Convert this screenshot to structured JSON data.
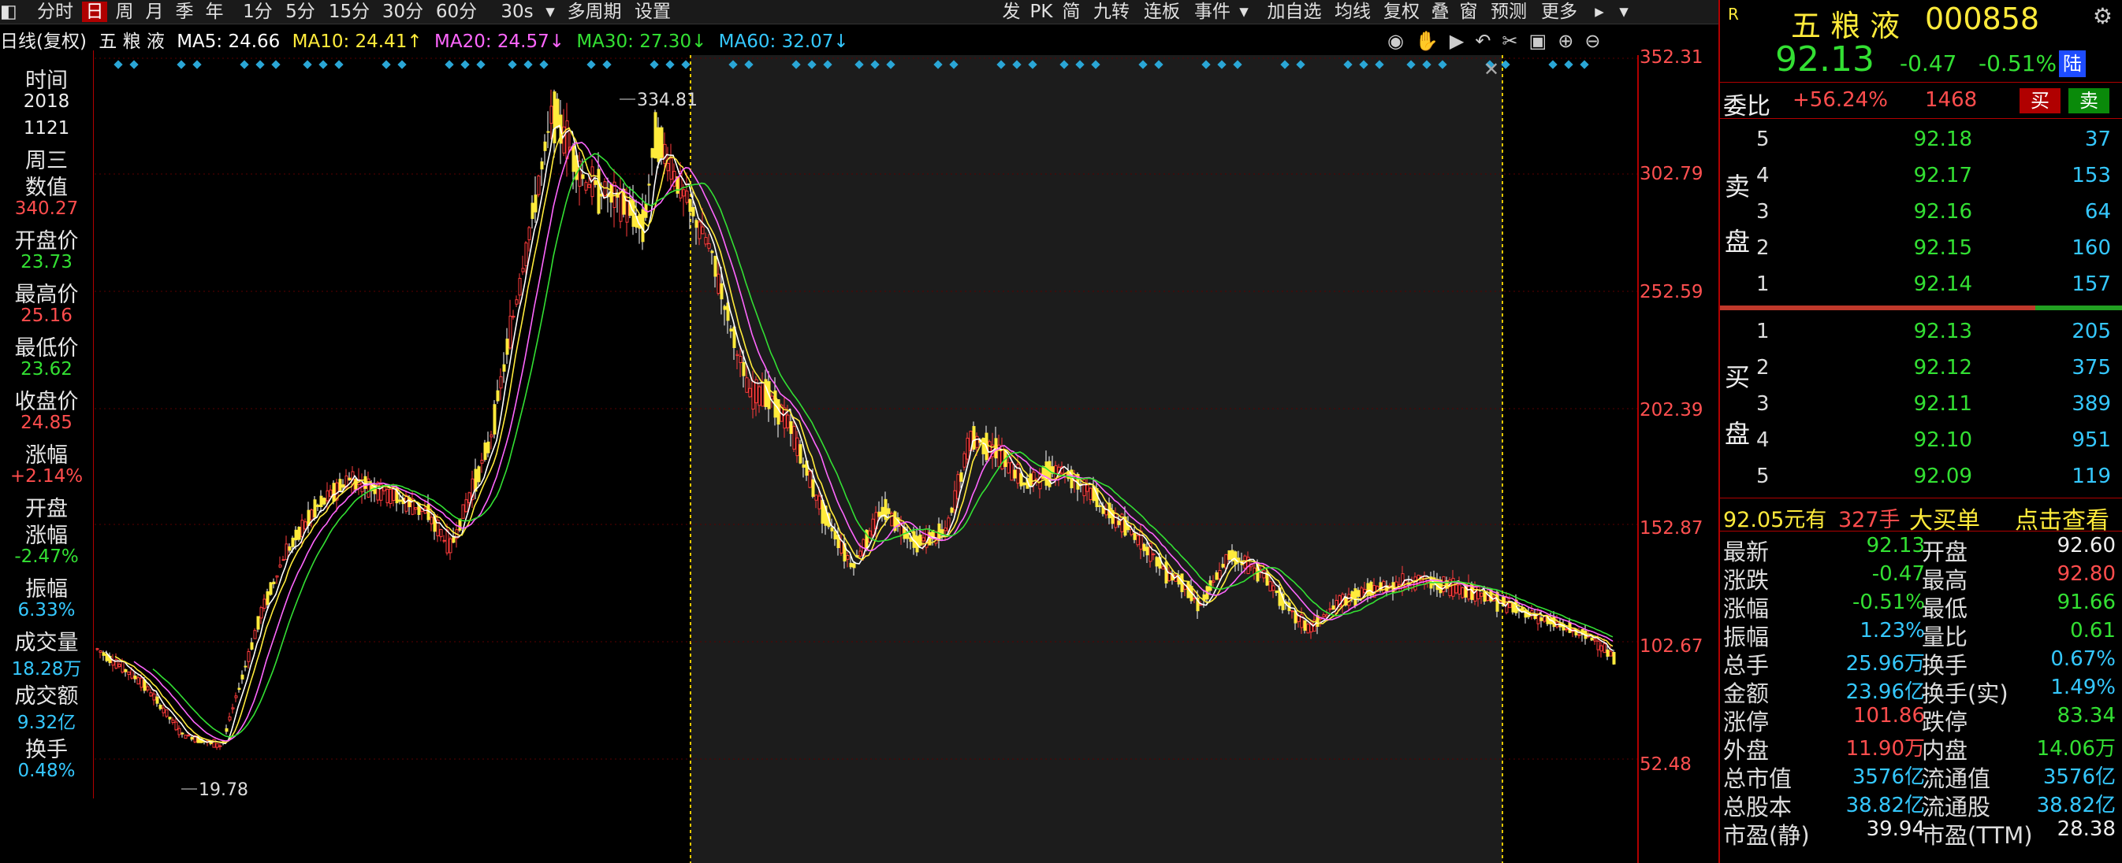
{
  "toolbar": {
    "items": [
      "分时",
      "日",
      "周",
      "月",
      "季",
      "年",
      "1分",
      "5分",
      "15分",
      "30分",
      "60分",
      "30s",
      "多周期",
      "设置"
    ],
    "active_item": "日",
    "right_items": [
      "发",
      "PK",
      "简",
      "九转",
      "连板",
      "事件",
      "加自选",
      "均线",
      "复权",
      "叠",
      "窗",
      "预测",
      "更多"
    ]
  },
  "ma_bar": {
    "period": "日线(复权)",
    "stock_name": "五 粮 液",
    "ma5": "MA5: 24.66",
    "ma10": "MA10: 24.41↑",
    "ma20": "MA20: 24.57↓",
    "ma30": "MA30: 27.30↓",
    "ma60": "MA60: 32.07↓",
    "colors": {
      "ma5": "#ffffff",
      "ma10": "#ffeb3b",
      "ma20": "#ff66ff",
      "ma30": "#33e033",
      "ma60": "#35c8ff"
    }
  },
  "left_info": {
    "time_label": "时间",
    "year": "2018",
    "date": "1121",
    "weekday": "周三",
    "value_label": "数值",
    "value": "340.27",
    "open_label": "开盘价",
    "open": "23.73",
    "high_label": "最高价",
    "high": "25.16",
    "low_label": "最低价",
    "low": "23.62",
    "close_label": "收盘价",
    "close": "24.85",
    "change_label": "涨幅",
    "change": "+2.14%",
    "open_change_label1": "开盘",
    "open_change_label2": "涨幅",
    "open_change": "-2.47%",
    "amplitude_label": "振幅",
    "amplitude": "6.33%",
    "volume_label": "成交量",
    "volume": "18.28万",
    "turnover_label": "成交额",
    "turnover": "9.32亿",
    "rate_label": "换手",
    "rate": "0.48%"
  },
  "price_axis": [
    "352.31",
    "302.79",
    "252.59",
    "202.39",
    "152.87",
    "102.67",
    "52.48"
  ],
  "chart_annotations": {
    "high_label": "334.81",
    "low_label": "19.78"
  },
  "quote": {
    "name": "五 粮 液",
    "code": "000858",
    "price": "92.13",
    "change": "-0.47",
    "change_pct": "-0.51%",
    "market_badge": "陆",
    "r_badge": "R",
    "weibi_label": "委比",
    "weibi": "+56.24%",
    "weicha": "1468",
    "buy_btn": "买",
    "sell_btn": "卖"
  },
  "order_book": {
    "sell_label": [
      "卖",
      "盘"
    ],
    "buy_label": [
      "买",
      "盘"
    ],
    "sell": [
      {
        "lvl": "5",
        "price": "92.18",
        "vol": "37"
      },
      {
        "lvl": "4",
        "price": "92.17",
        "vol": "153"
      },
      {
        "lvl": "3",
        "price": "92.16",
        "vol": "64"
      },
      {
        "lvl": "2",
        "price": "92.15",
        "vol": "160"
      },
      {
        "lvl": "1",
        "price": "92.14",
        "vol": "157"
      }
    ],
    "buy": [
      {
        "lvl": "1",
        "price": "92.13",
        "vol": "205"
      },
      {
        "lvl": "2",
        "price": "92.12",
        "vol": "375"
      },
      {
        "lvl": "3",
        "price": "92.11",
        "vol": "389"
      },
      {
        "lvl": "4",
        "price": "92.10",
        "vol": "951"
      },
      {
        "lvl": "5",
        "price": "92.09",
        "vol": "119"
      }
    ]
  },
  "big_order": {
    "price": "92.05元有",
    "qty": "327手",
    "label": "大买单",
    "link": "点击查看"
  },
  "stats": [
    {
      "l": "最新",
      "v": "92.13",
      "c": "green",
      "l2": "开盘",
      "v2": "92.60",
      "c2": "white"
    },
    {
      "l": "涨跌",
      "v": "-0.47",
      "c": "green",
      "l2": "最高",
      "v2": "92.80",
      "c2": "red"
    },
    {
      "l": "涨幅",
      "v": "-0.51%",
      "c": "green",
      "l2": "最低",
      "v2": "91.66",
      "c2": "green"
    },
    {
      "l": "振幅",
      "v": "1.23%",
      "c": "cyan",
      "l2": "量比",
      "v2": "0.61",
      "c2": "green"
    },
    {
      "l": "总手",
      "v": "25.96万",
      "c": "cyan",
      "l2": "换手",
      "v2": "0.67%",
      "c2": "cyan"
    },
    {
      "l": "金额",
      "v": "23.96亿",
      "c": "cyan",
      "l2": "换手(实)",
      "v2": "1.49%",
      "c2": "cyan"
    },
    {
      "l": "涨停",
      "v": "101.86",
      "c": "red",
      "l2": "跌停",
      "v2": "83.34",
      "c2": "green"
    },
    {
      "l": "外盘",
      "v": "11.90万",
      "c": "red",
      "l2": "内盘",
      "v2": "14.06万",
      "c2": "green"
    },
    {
      "l": "总市值",
      "v": "3576亿",
      "c": "cyan",
      "l2": "流通值",
      "v2": "3576亿",
      "c2": "cyan"
    },
    {
      "l": "总股本",
      "v": "38.82亿",
      "c": "cyan",
      "l2": "流通股",
      "v2": "38.82亿",
      "c2": "cyan"
    },
    {
      "l": "市盈(静)",
      "v": "39.94",
      "c": "white",
      "l2": "市盈(TTM)",
      "v2": "28.38",
      "c2": "white"
    }
  ]
}
